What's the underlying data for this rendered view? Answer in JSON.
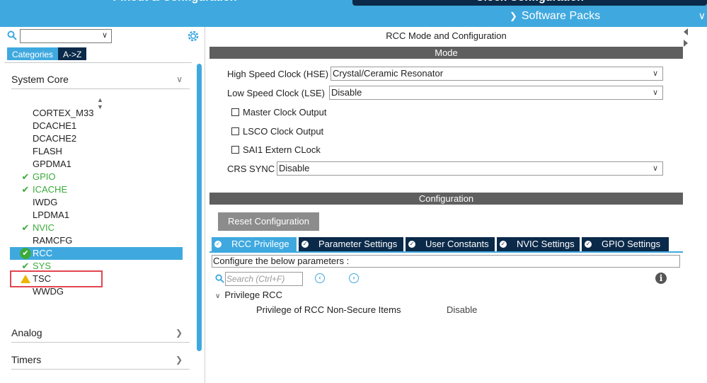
{
  "top": {
    "pinout_tab": "Pinout & Configuration",
    "clock_tab": "Clock Configuration",
    "software_packs": "Software Packs"
  },
  "left": {
    "search": {
      "value": ""
    },
    "tabs": {
      "categories": "Categories",
      "az": "A->Z"
    },
    "groups": {
      "system_core": "System Core",
      "analog": "Analog",
      "timers": "Timers"
    },
    "peripherals": [
      {
        "label": "CORTEX_M33",
        "status": "none"
      },
      {
        "label": "DCACHE1",
        "status": "none"
      },
      {
        "label": "DCACHE2",
        "status": "none"
      },
      {
        "label": "FLASH",
        "status": "none"
      },
      {
        "label": "GPDMA1",
        "status": "none"
      },
      {
        "label": "GPIO",
        "status": "ok"
      },
      {
        "label": "ICACHE",
        "status": "ok"
      },
      {
        "label": "IWDG",
        "status": "none"
      },
      {
        "label": "LPDMA1",
        "status": "none"
      },
      {
        "label": "NVIC",
        "status": "ok"
      },
      {
        "label": "RAMCFG",
        "status": "none"
      },
      {
        "label": "RCC",
        "status": "selected"
      },
      {
        "label": "SYS",
        "status": "ok"
      },
      {
        "label": "TSC",
        "status": "warning"
      },
      {
        "label": "WWDG",
        "status": "none"
      }
    ]
  },
  "main": {
    "title": "RCC Mode and Configuration",
    "mode_bar": "Mode",
    "hse": {
      "label": "High Speed Clock (HSE)",
      "value": "Crystal/Ceramic Resonator"
    },
    "lse": {
      "label": "Low Speed Clock (LSE)",
      "value": "Disable"
    },
    "checks": {
      "mco": "Master Clock Output",
      "lsco": "LSCO Clock Output",
      "sai1": "SAI1 Extern CLock"
    },
    "crs": {
      "label": "CRS SYNC",
      "value": "Disable"
    },
    "config_bar": "Configuration",
    "reset_button": "Reset Configuration",
    "tabs": {
      "rcc_privilege": "RCC Privilege",
      "parameter_settings": "Parameter Settings",
      "user_constants": "User Constants",
      "nvic_settings": "NVIC Settings",
      "gpio_settings": "GPIO Settings"
    },
    "configure_text": "Configure the below parameters :",
    "param_search_placeholder": "Search (Ctrl+F)",
    "tree": {
      "group": "Privilege RCC",
      "param_name": "Privilege of RCC Non-Secure Items",
      "param_value": "Disable"
    }
  },
  "colors": {
    "accent": "#3fa9df",
    "dark": "#0b2a4a",
    "ok": "#3bab3b",
    "warning": "#f0b400",
    "highlight": "#e3464f"
  }
}
